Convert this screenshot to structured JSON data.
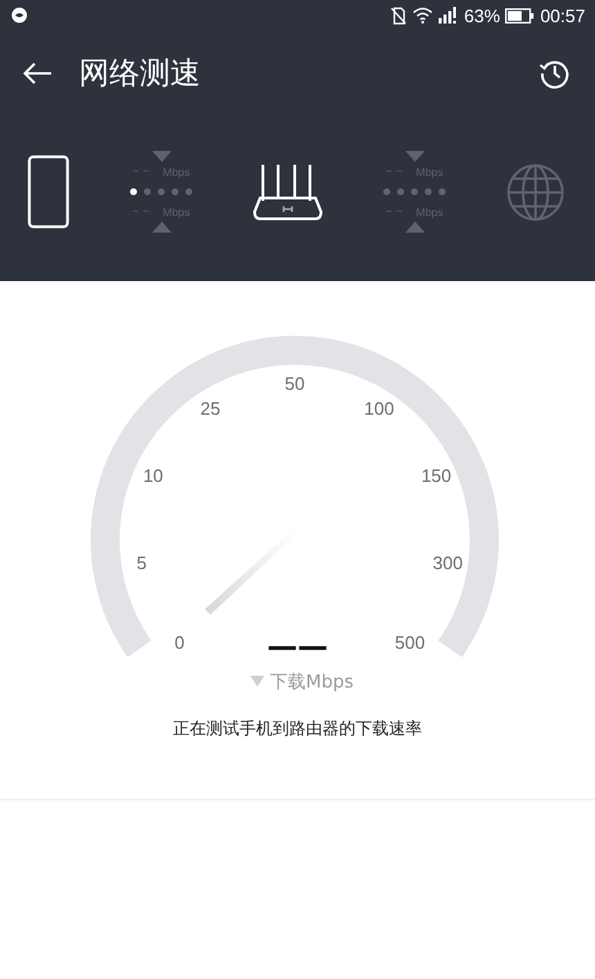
{
  "status_bar": {
    "battery": "63%",
    "time": "00:57"
  },
  "header": {
    "title": "网络测速"
  },
  "links": [
    {
      "download": {
        "value": "– –",
        "unit": "Mbps"
      },
      "upload": {
        "value": "– –",
        "unit": "Mbps"
      },
      "dots": [
        {
          "on": true
        },
        {
          "on": false
        },
        {
          "on": false
        },
        {
          "on": false
        },
        {
          "on": false
        }
      ]
    },
    {
      "download": {
        "value": "– –",
        "unit": "Mbps"
      },
      "upload": {
        "value": "– –",
        "unit": "Mbps"
      },
      "dots": [
        {
          "on": false
        },
        {
          "on": false
        },
        {
          "on": false
        },
        {
          "on": false
        },
        {
          "on": false
        }
      ]
    }
  ],
  "gauge": {
    "labels": [
      "0",
      "5",
      "10",
      "25",
      "50",
      "100",
      "150",
      "300",
      "500"
    ],
    "reading": "——",
    "unit": "下载Mbps"
  },
  "caption": "正在测试手机到路由器的下载速率"
}
